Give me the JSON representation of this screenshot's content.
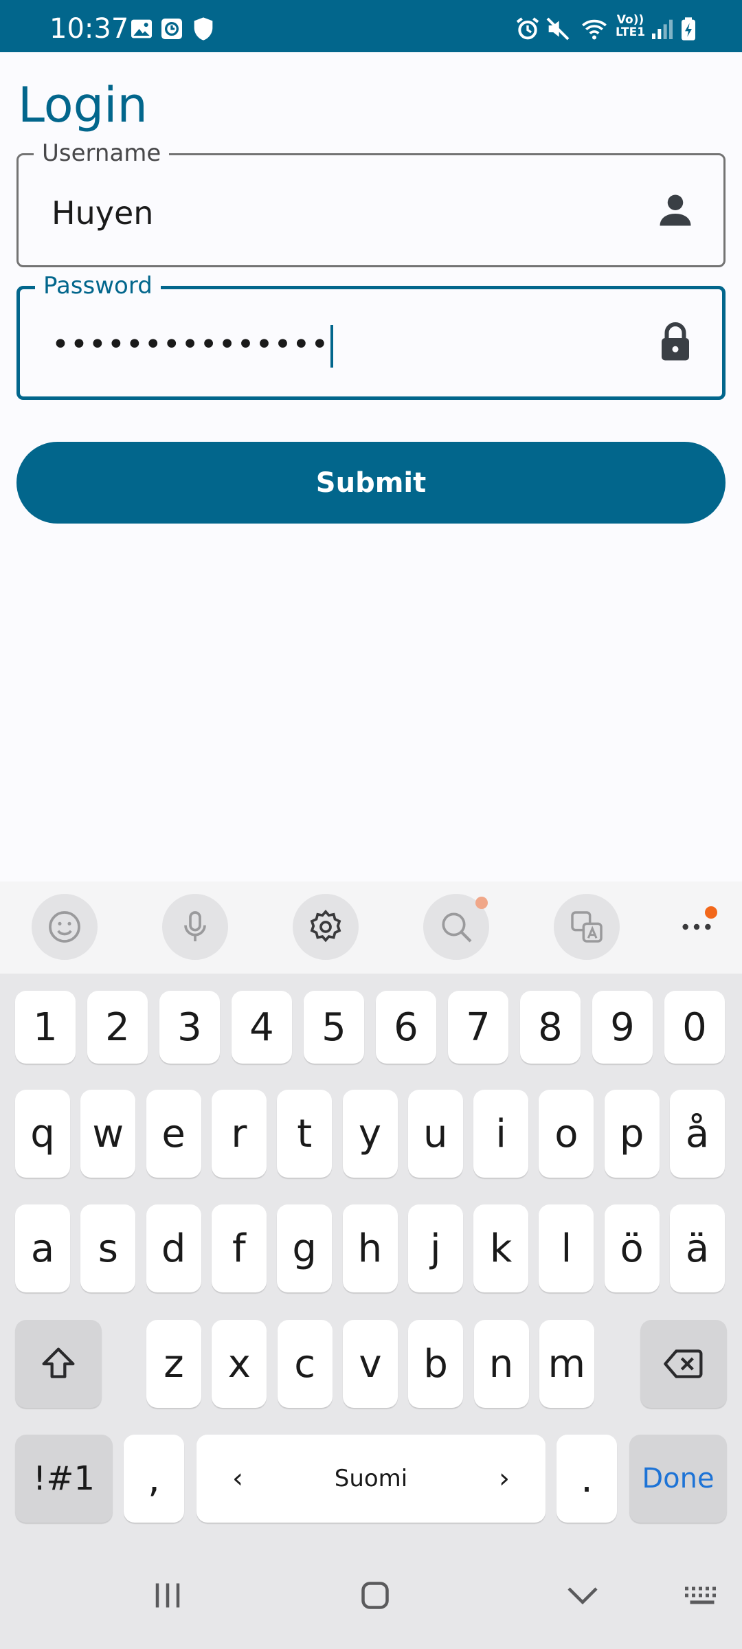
{
  "status_bar": {
    "time": "10:37",
    "left_icons": [
      "image-icon",
      "screen-record-icon",
      "shield-icon"
    ],
    "right_icons": [
      "alarm-icon",
      "mute-icon",
      "wifi-icon",
      "volte-icon",
      "signal-icon",
      "battery-charging-icon"
    ],
    "volte_line1": "Vo))",
    "volte_line2": "LTE1",
    "background": "#02668c"
  },
  "screen": {
    "title": "Login",
    "username": {
      "label": "Username",
      "value": "Huyen",
      "icon": "person-icon"
    },
    "password": {
      "label": "Password",
      "value": "•••••••••••••••",
      "icon": "lock-icon"
    },
    "submit_label": "Submit",
    "accent": "#02668c"
  },
  "keyboard": {
    "toolbar": [
      "emoji-icon",
      "mic-icon",
      "settings-icon",
      "search-icon",
      "translate-icon",
      "more-icon"
    ],
    "number_row": [
      "1",
      "2",
      "3",
      "4",
      "5",
      "6",
      "7",
      "8",
      "9",
      "0"
    ],
    "row1": [
      "q",
      "w",
      "e",
      "r",
      "t",
      "y",
      "u",
      "i",
      "o",
      "p",
      "å"
    ],
    "row2": [
      "a",
      "s",
      "d",
      "f",
      "g",
      "h",
      "j",
      "k",
      "l",
      "ö",
      "ä"
    ],
    "row3": [
      "z",
      "x",
      "c",
      "v",
      "b",
      "n",
      "m"
    ],
    "symbols_label": "!#1",
    "comma_label": ",",
    "space_label": "Suomi",
    "space_left": "‹",
    "space_right": "›",
    "period_label": ".",
    "done_label": "Done",
    "done_color": "#1d73d6"
  },
  "nav_bar": [
    "recents-icon",
    "home-icon",
    "back-icon",
    "keyboard-icon"
  ]
}
